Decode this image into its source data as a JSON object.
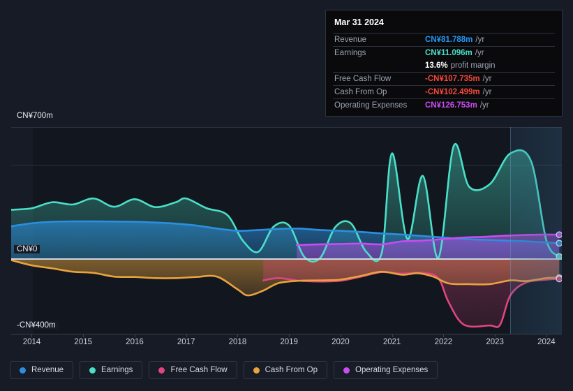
{
  "axes": {
    "y_labels": [
      {
        "text": "CN¥700m",
        "y": 160
      },
      {
        "text": "CN¥0",
        "y": 351
      },
      {
        "text": "-CN¥400m",
        "y": 460
      }
    ],
    "x_labels": [
      "2014",
      "2015",
      "2016",
      "2017",
      "2018",
      "2019",
      "2020",
      "2021",
      "2022",
      "2023",
      "2024"
    ],
    "currency": "CN¥"
  },
  "tooltip": {
    "date": "Mar 31 2024",
    "rows": [
      {
        "key": "Revenue",
        "value": "CN¥81.788m",
        "unit": "/yr",
        "color": "#2196f3"
      },
      {
        "key": "Earnings",
        "value": "CN¥11.096m",
        "unit": "/yr",
        "color": "#4adfc8"
      },
      {
        "key": "",
        "value": "13.6%",
        "unit": "profit margin",
        "color": "#ffffff"
      },
      {
        "key": "Free Cash Flow",
        "value": "-CN¥107.735m",
        "unit": "/yr",
        "color": "#f4483b"
      },
      {
        "key": "Cash From Op",
        "value": "-CN¥102.499m",
        "unit": "/yr",
        "color": "#f4483b"
      },
      {
        "key": "Operating Expenses",
        "value": "CN¥126.753m",
        "unit": "/yr",
        "color": "#c74df0"
      }
    ]
  },
  "legend": {
    "items": [
      {
        "label": "Revenue",
        "color": "#2b8fe0"
      },
      {
        "label": "Earnings",
        "color": "#4adfc8"
      },
      {
        "label": "Free Cash Flow",
        "color": "#e0457f"
      },
      {
        "label": "Cash From Op",
        "color": "#e8a33d"
      },
      {
        "label": "Operating Expenses",
        "color": "#c74df0"
      }
    ]
  },
  "chart_data": {
    "type": "area",
    "title": "",
    "xlabel": "",
    "ylabel": "CN¥",
    "ylim": [
      -400,
      700
    ],
    "grid": true,
    "legend_position": "bottom",
    "x_range": [
      2013.6,
      2024.3
    ],
    "forecast_start": 2023.3,
    "series": [
      {
        "name": "Revenue",
        "color": "#2b8fe0",
        "x": [
          2013.6,
          2014.0,
          2014.4,
          2014.8,
          2015.2,
          2015.6,
          2016.0,
          2016.4,
          2016.8,
          2017.2,
          2017.6,
          2018.0,
          2018.4,
          2018.8,
          2019.2,
          2019.6,
          2020.0,
          2020.4,
          2020.8,
          2021.2,
          2021.6,
          2022.0,
          2022.4,
          2022.8,
          2023.2,
          2023.6,
          2024.0,
          2024.25
        ],
        "values": [
          172,
          188,
          196,
          198,
          198,
          197,
          196,
          192,
          186,
          176,
          160,
          148,
          152,
          158,
          160,
          152,
          148,
          142,
          134,
          128,
          120,
          112,
          104,
          100,
          96,
          92,
          86,
          82
        ]
      },
      {
        "name": "Earnings",
        "color": "#4adfc8",
        "x": [
          2013.6,
          2014.0,
          2014.4,
          2014.8,
          2015.2,
          2015.6,
          2016.0,
          2016.4,
          2016.8,
          2017.0,
          2017.4,
          2017.8,
          2018.1,
          2018.4,
          2018.7,
          2019.0,
          2019.3,
          2019.6,
          2019.9,
          2020.2,
          2020.5,
          2020.8,
          2021.0,
          2021.3,
          2021.6,
          2021.9,
          2022.2,
          2022.5,
          2022.9,
          2023.3,
          2023.7,
          2024.0,
          2024.25
        ],
        "values": [
          260,
          268,
          300,
          288,
          320,
          276,
          316,
          274,
          300,
          320,
          268,
          232,
          96,
          36,
          170,
          176,
          8,
          2,
          168,
          188,
          36,
          30,
          560,
          104,
          440,
          4,
          600,
          382,
          396,
          560,
          520,
          96,
          11
        ]
      },
      {
        "name": "Free Cash Flow",
        "color": "#e0457f",
        "x": [
          2018.5,
          2018.8,
          2019.2,
          2019.6,
          2020.0,
          2020.4,
          2020.8,
          2021.2,
          2021.6,
          2021.9,
          2022.1,
          2022.4,
          2022.9,
          2023.1,
          2023.3,
          2023.6,
          2024.0,
          2024.25
        ],
        "values": [
          -116,
          -104,
          -118,
          -122,
          -118,
          -96,
          -72,
          -80,
          -76,
          -104,
          -232,
          -352,
          -356,
          -352,
          -196,
          -128,
          -112,
          -108
        ]
      },
      {
        "name": "Cash From Op",
        "color": "#e8a33d",
        "x": [
          2013.6,
          2014.0,
          2014.4,
          2014.8,
          2015.2,
          2015.6,
          2016.0,
          2016.4,
          2016.8,
          2017.2,
          2017.6,
          2018.0,
          2018.2,
          2018.5,
          2018.8,
          2019.2,
          2019.6,
          2020.0,
          2020.4,
          2020.8,
          2021.2,
          2021.5,
          2021.8,
          2022.1,
          2022.5,
          2022.9,
          2023.3,
          2023.6,
          2024.0,
          2024.25
        ],
        "values": [
          -8,
          -36,
          -52,
          -70,
          -76,
          -96,
          -98,
          -104,
          -104,
          -98,
          -96,
          -164,
          -196,
          -170,
          -130,
          -118,
          -116,
          -112,
          -92,
          -70,
          -86,
          -78,
          -96,
          -132,
          -136,
          -136,
          -116,
          -120,
          -104,
          -102
        ]
      },
      {
        "name": "Operating Expenses",
        "color": "#c74df0",
        "x": [
          2019.15,
          2019.6,
          2020.0,
          2020.4,
          2020.8,
          2021.2,
          2021.6,
          2022.0,
          2022.4,
          2022.8,
          2023.2,
          2023.6,
          2024.0,
          2024.25
        ],
        "values": [
          72,
          76,
          78,
          80,
          76,
          92,
          96,
          104,
          112,
          116,
          122,
          126,
          128,
          127
        ]
      }
    ]
  }
}
